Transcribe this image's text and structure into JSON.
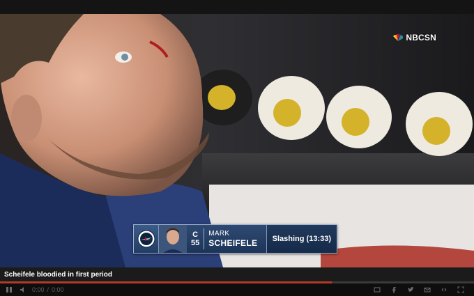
{
  "video": {
    "network_logo_text": "NBCSN",
    "network_logo_icon": "peacock-icon"
  },
  "lower_third": {
    "team_logo_icon": "jets-logo-icon",
    "position": "C",
    "number": "55",
    "first_name": "MARK",
    "last_name": "SCHEIFELE",
    "penalty": "Slashing (13:33)"
  },
  "caption": {
    "title": "Scheifele bloodied in first period"
  },
  "player_controls": {
    "progress_fraction": 0.7,
    "current_time": "0:00",
    "duration": "0:00",
    "icons": {
      "play": "play-icon",
      "volume": "volume-icon",
      "embed": "embed-icon",
      "facebook": "facebook-icon",
      "twitter": "twitter-icon",
      "email": "email-icon",
      "share": "share-icon",
      "fullscreen": "fullscreen-icon"
    }
  }
}
